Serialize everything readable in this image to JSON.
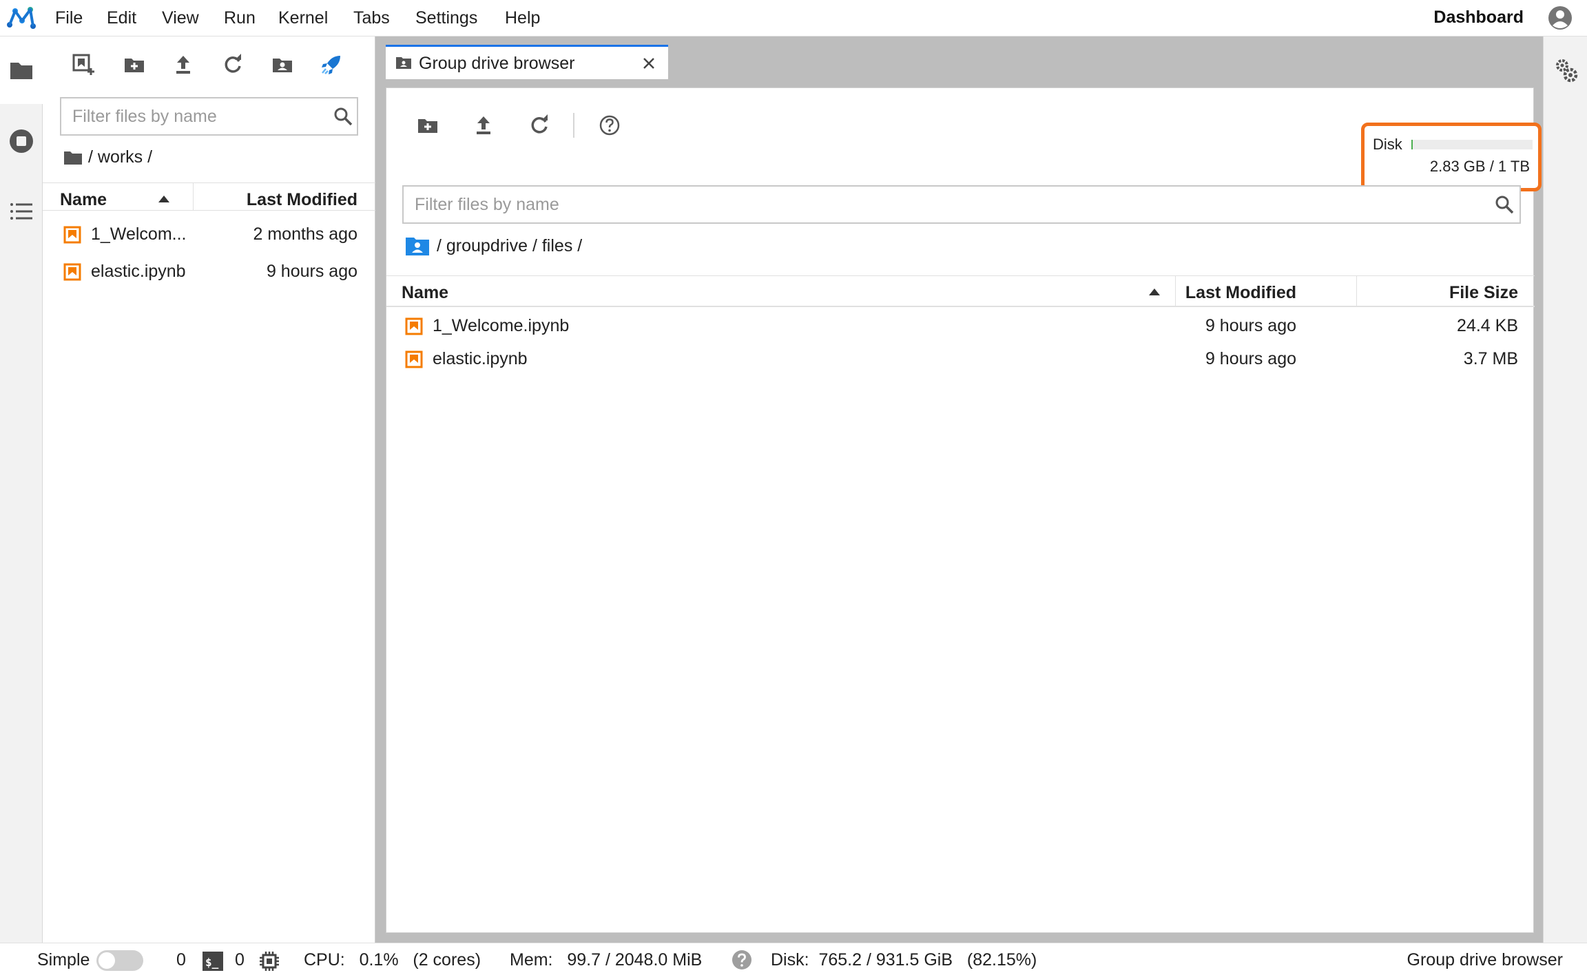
{
  "menubar": {
    "items": [
      "File",
      "Edit",
      "View",
      "Run",
      "Kernel",
      "Tabs",
      "Settings",
      "Help"
    ],
    "dashboard": "Dashboard"
  },
  "left_panel": {
    "filter_placeholder": "Filter files by name",
    "breadcrumb": "/ works /",
    "columns": {
      "name": "Name",
      "modified": "Last Modified"
    },
    "files": [
      {
        "name": "1_Welcom...",
        "modified": "2 months ago"
      },
      {
        "name": "elastic.ipynb",
        "modified": "9 hours ago"
      }
    ]
  },
  "main": {
    "tab_title": "Group drive browser",
    "disk": {
      "label": "Disk",
      "text": "2.83 GB / 1 TB",
      "used_fraction": 0.003
    },
    "filter_placeholder": "Filter files by name",
    "breadcrumb": "/ groupdrive / files /",
    "columns": {
      "name": "Name",
      "modified": "Last Modified",
      "size": "File Size"
    },
    "files": [
      {
        "name": "1_Welcome.ipynb",
        "modified": "9 hours ago",
        "size": "24.4 KB"
      },
      {
        "name": "elastic.ipynb",
        "modified": "9 hours ago",
        "size": "3.7 MB"
      }
    ]
  },
  "statusbar": {
    "mode_label": "Simple",
    "kernels_count": "0",
    "terminals_count": "0",
    "cpu": "CPU:   0.1%   (2 cores)",
    "mem": "Mem:   99.7 / 2048.0 MiB",
    "disk": "Disk:  765.2 / 931.5 GiB   (82.15%)",
    "active_label": "Group drive browser"
  },
  "colors": {
    "accent": "#1a73e8",
    "notebook": "#f57c00",
    "highlight": "#f2711c"
  }
}
